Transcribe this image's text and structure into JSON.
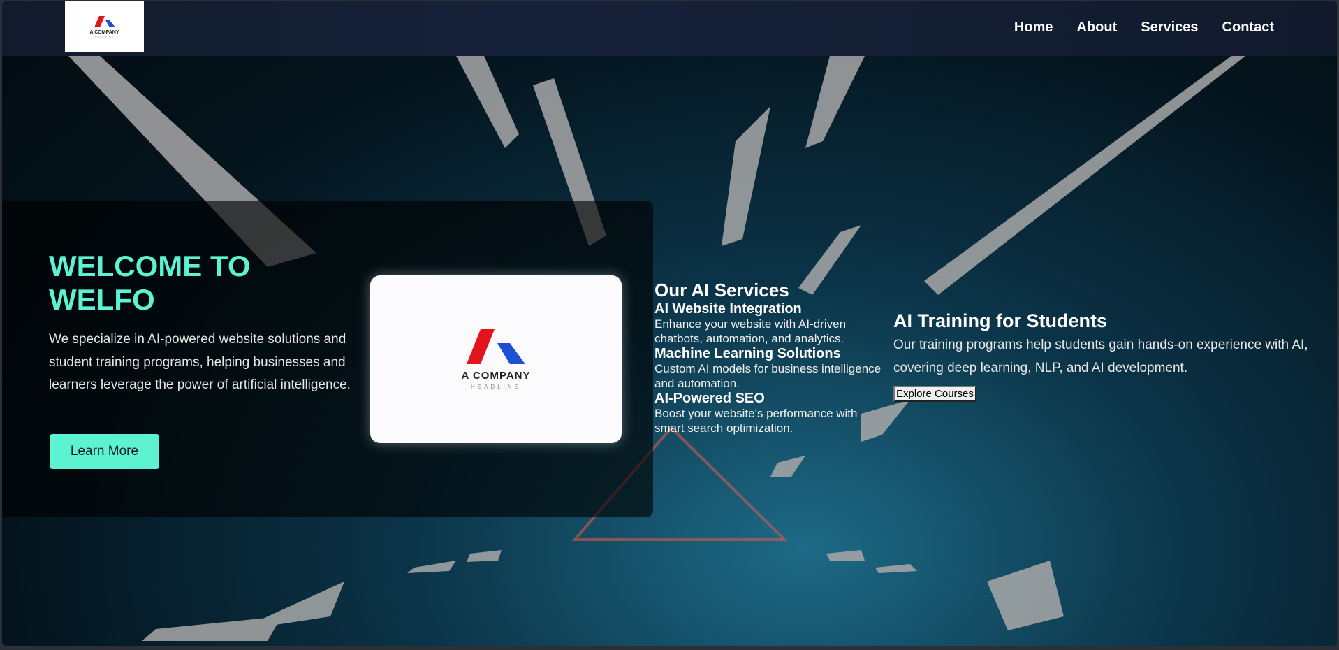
{
  "nav": {
    "logo_text": "A COMPANY",
    "logo_sub": "HEADLINE",
    "links": [
      "Home",
      "About",
      "Services",
      "Contact"
    ]
  },
  "hero": {
    "title": "WELCOME TO WELFO",
    "description": "We specialize in AI-powered website solutions and student training programs, helping businesses and learners leverage the power of artificial intelligence.",
    "button_label": "Learn More",
    "card_logo_text": "A COMPANY",
    "card_logo_sub": "HEADLINE"
  },
  "services": {
    "heading": "Our AI Services",
    "items": [
      {
        "title": "AI Website Integration",
        "desc": "Enhance your website with AI-driven chatbots, automation, and analytics."
      },
      {
        "title": "Machine Learning Solutions",
        "desc": "Custom AI models for business intelligence and automation."
      },
      {
        "title": "AI-Powered SEO",
        "desc": "Boost your website's performance with smart search optimization."
      }
    ]
  },
  "training": {
    "heading": "AI Training for Students",
    "description": "Our training programs help students gain hands-on experience with AI, covering deep learning, NLP, and AI development.",
    "button_label": "Explore Courses"
  },
  "colors": {
    "accent": "#5cf2d2",
    "logo_red": "#e3141b",
    "logo_blue": "#1a4fd6"
  }
}
